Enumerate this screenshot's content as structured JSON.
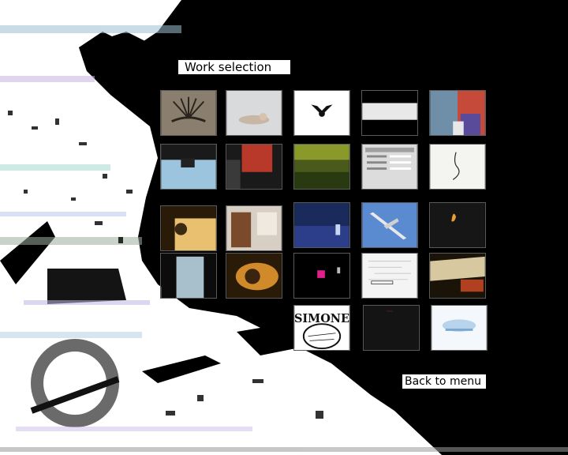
{
  "screen": {
    "title": "Work selection",
    "back_label": "Back to menu"
  },
  "thumbnails": [
    {
      "id": "t01",
      "logo_text": ""
    },
    {
      "id": "t02"
    },
    {
      "id": "t03"
    },
    {
      "id": "t04"
    },
    {
      "id": "t05"
    },
    {
      "id": "t06"
    },
    {
      "id": "t07"
    },
    {
      "id": "t08"
    },
    {
      "id": "t09"
    },
    {
      "id": "t10"
    },
    {
      "id": "t11"
    },
    {
      "id": "t12"
    },
    {
      "id": "t13"
    },
    {
      "id": "t14"
    },
    {
      "id": "t15"
    },
    {
      "id": "t16"
    },
    {
      "id": "t17"
    },
    {
      "id": "t18"
    },
    {
      "id": "t19"
    },
    {
      "id": "t20"
    },
    {
      "id": "t21",
      "logo_text": "SIMONE"
    },
    {
      "id": "t22"
    },
    {
      "id": "t23"
    }
  ],
  "colors": {
    "background": "#ffffff",
    "silhouette": "#000000",
    "label_bg": "#ffffff",
    "label_text": "#000000",
    "thumb_border": "#5a5a5a"
  }
}
